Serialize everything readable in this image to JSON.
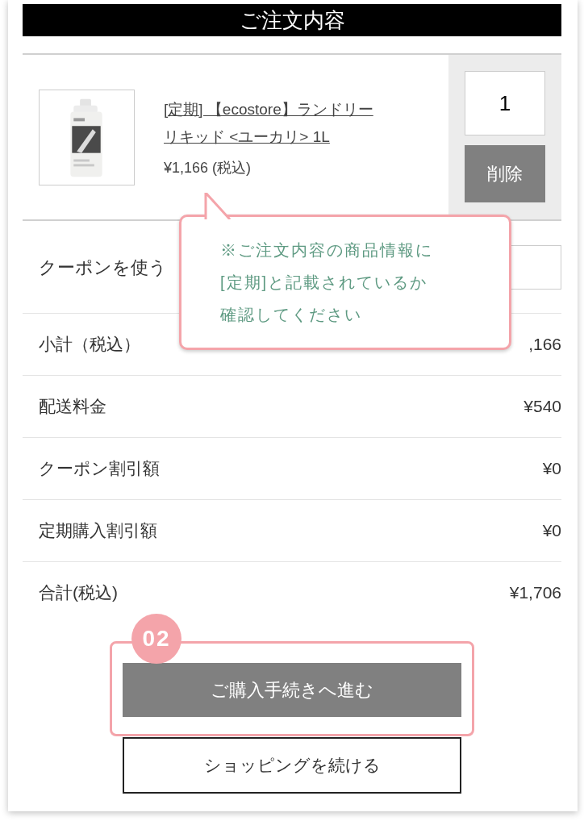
{
  "header": {
    "title": "ご注文内容"
  },
  "cart_item": {
    "name_line_1": "[定期] 【ecostore】ランドリー",
    "name_line_2": "リキッド <ユーカリ> 1L",
    "price": "¥1,166 (税込)",
    "quantity": "1",
    "delete_button": "削除"
  },
  "coupon": {
    "label": "クーポンを使う"
  },
  "summary_rows": [
    {
      "label": "小計（税込）",
      "value": ",166"
    },
    {
      "label": "配送料金",
      "value": "¥540"
    },
    {
      "label": "クーポン割引額",
      "value": "¥0"
    },
    {
      "label": "定期購入割引額",
      "value": "¥0"
    },
    {
      "label": "合計(税込)",
      "value": "¥1,706"
    }
  ],
  "callout": {
    "lines": [
      "※ご注文内容の商品情報に",
      "[定期]と記載されているか",
      "確認してください"
    ]
  },
  "step_badge": "02",
  "checkout_button": "ご購入手続きへ進む",
  "continue_button": "ショッピングを続ける"
}
